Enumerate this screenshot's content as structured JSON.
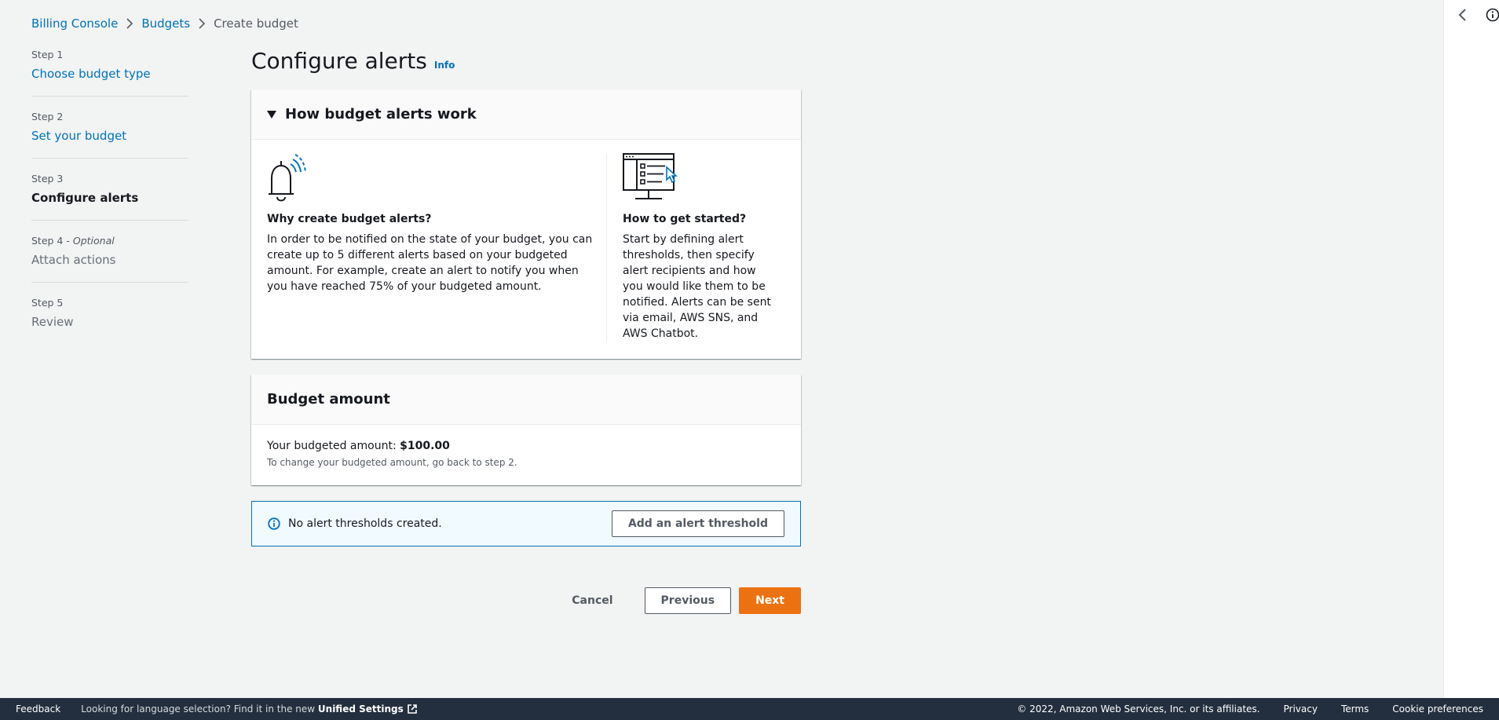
{
  "breadcrumb": {
    "items": [
      "Billing Console",
      "Budgets",
      "Create budget"
    ]
  },
  "steps": [
    {
      "num": "Step 1",
      "label": "Choose budget type"
    },
    {
      "num": "Step 2",
      "label": "Set your budget"
    },
    {
      "num": "Step 3",
      "label": "Configure alerts"
    },
    {
      "num": "Step 4",
      "optional": "Optional",
      "label": "Attach actions"
    },
    {
      "num": "Step 5",
      "label": "Review"
    }
  ],
  "page": {
    "title": "Configure alerts",
    "info_label": "Info"
  },
  "how_panel": {
    "title": "How budget alerts work",
    "left": {
      "heading": "Why create budget alerts?",
      "text": "In order to be notified on the state of your budget, you can create up to 5 different alerts based on your budgeted amount. For example, create an alert to notify you when you have reached 75% of your budgeted amount.",
      "icon": "bell-icon"
    },
    "right": {
      "heading": "How to get started?",
      "text": "Start by defining alert thresholds, then specify alert recipients and how you would like them to be notified. Alerts can be sent via email, AWS SNS, and AWS Chatbot.",
      "icon": "monitor-checklist-icon"
    }
  },
  "budget_panel": {
    "title": "Budget amount",
    "amount_label": "Your budgeted amount:",
    "amount_value": "$100.00",
    "hint": "To change your budgeted amount, go back to step 2."
  },
  "alert_box": {
    "message": "No alert thresholds created.",
    "button": "Add an alert threshold"
  },
  "actions": {
    "cancel": "Cancel",
    "previous": "Previous",
    "next": "Next"
  },
  "footer": {
    "feedback": "Feedback",
    "lang_text": "Looking for language selection? Find it in the new",
    "unified_settings": "Unified Settings",
    "copyright": "© 2022, Amazon Web Services, Inc. or its affiliates.",
    "privacy": "Privacy",
    "terms": "Terms",
    "cookie": "Cookie preferences"
  },
  "colors": {
    "link": "#0073bb",
    "primary": "#ec7211",
    "footer_bg": "#232f3e",
    "alert_border": "#0073bb",
    "alert_bg": "#f1faff"
  }
}
